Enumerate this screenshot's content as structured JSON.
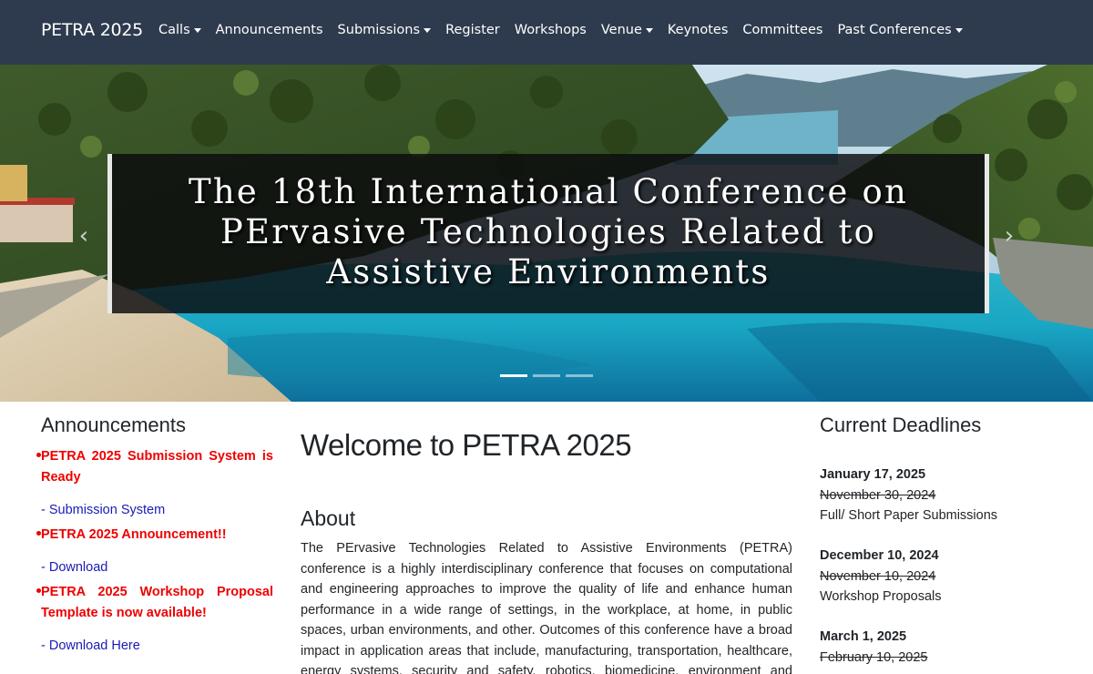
{
  "navbar": {
    "brand": "PETRA 2025",
    "items": [
      {
        "label": "Calls",
        "dropdown": true
      },
      {
        "label": "Announcements",
        "dropdown": false
      },
      {
        "label": "Submissions",
        "dropdown": true
      },
      {
        "label": "Register",
        "dropdown": false
      },
      {
        "label": "Workshops",
        "dropdown": false
      },
      {
        "label": "Venue",
        "dropdown": true
      },
      {
        "label": "Keynotes",
        "dropdown": false
      },
      {
        "label": "Committees",
        "dropdown": false
      },
      {
        "label": "Past Conferences",
        "dropdown": true
      }
    ]
  },
  "hero": {
    "title_line1": "The 18th International Conference on",
    "title_line2": "PErvasive Technologies Related to",
    "title_line3": "Assistive Environments",
    "prev_icon": "chevron-left-icon",
    "next_icon": "chevron-right-icon",
    "slide_count": 3,
    "active_slide": 1
  },
  "announcements": {
    "heading": "Announcements",
    "items": [
      {
        "title": "PETRA 2025 Submission System is Ready",
        "link": "- Submission System"
      },
      {
        "title": "PETRA 2025 Announcement!!",
        "link": "- Download"
      },
      {
        "title": "PETRA 2025 Workshop Proposal Template is now available!",
        "link": "- Download Here"
      }
    ]
  },
  "main": {
    "welcome": "Welcome to PETRA 2025",
    "about_heading": "About",
    "about_text": "The PErvasive Technologies Related to Assistive Environments (PETRA) conference is a highly interdisciplinary conference that focuses on computational and engineering approaches to improve the quality of life and enhance human performance in a wide range of settings, in the workplace, at home, in public spaces, urban environments, and other. Outcomes of this conference have a broad impact in application areas that include, manufacturing, transportation, healthcare, energy systems, security and safety, robotics, biomedicine, environment and conservation,"
  },
  "deadlines": {
    "heading": "Current Deadlines",
    "items": [
      {
        "date": "January 17, 2025",
        "old": "November 30, 2024",
        "desc": "Full/ Short Paper Submissions"
      },
      {
        "date": "December 10, 2024",
        "old": "November 10, 2024",
        "desc": "Workshop Proposals"
      },
      {
        "date": "March 1, 2025",
        "old": "February 10, 2025",
        "desc": ""
      }
    ]
  },
  "colors": {
    "navbar_bg": "#2e3b4e",
    "announcement_red": "#e00000",
    "link_blue": "#1a1ab8"
  }
}
